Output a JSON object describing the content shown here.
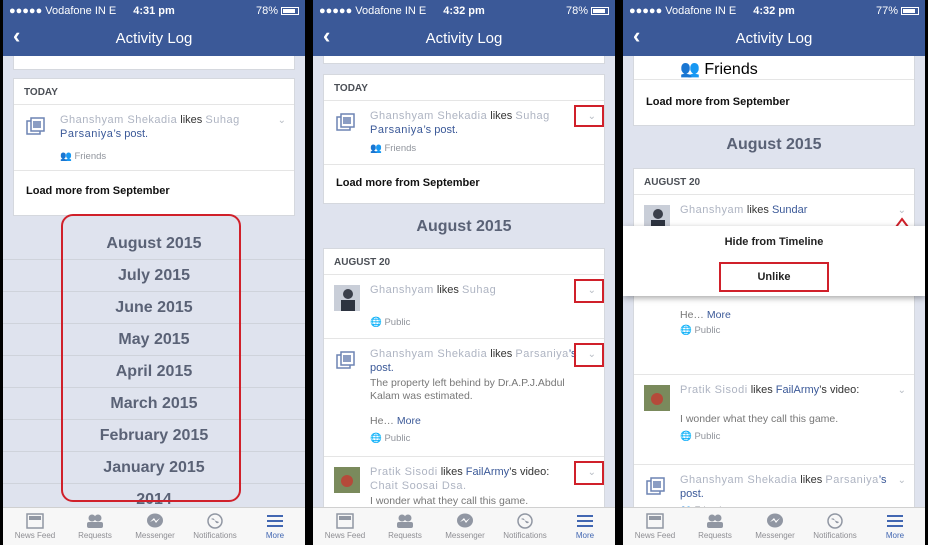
{
  "status": {
    "p1": {
      "carrier": "●●●●● Vodafone IN  E",
      "time": "4:31 pm",
      "battery": "78%"
    },
    "p2": {
      "carrier": "●●●●● Vodafone IN  E",
      "time": "4:32 pm",
      "battery": "78%"
    },
    "p3": {
      "carrier": "●●●●● Vodafone IN  E",
      "time": "4:32 pm",
      "battery": "77%"
    }
  },
  "nav": {
    "back": "‹",
    "title": "Activity Log"
  },
  "labels": {
    "today": "TODAY",
    "aug20": "AUGUST 20",
    "load_more": "Load more from September",
    "aug2015": "August 2015",
    "likes": "likes",
    "post": "’s post.",
    "video": "’s video:",
    "friends": "Friends",
    "public": "Public",
    "more": "More",
    "he": "He…",
    "property": "The property left behind by Dr.A.P.J.Abdul Kalam was estimated.",
    "wonder": "I wonder what they call this game.",
    "failarmy": "FailArmy",
    "sundar": "Sundar"
  },
  "blurred": {
    "name1": "Ghanshyam Shekadia",
    "name2": "Suhag",
    "name3": "Parsaniya",
    "name4": "Ghanshyam",
    "name5": "Pratik Sisodi",
    "name6": "Chait Soosai Dsa."
  },
  "months": [
    "August 2015",
    "July 2015",
    "June 2015",
    "May 2015",
    "April 2015",
    "March 2015",
    "February 2015",
    "January 2015",
    "2014"
  ],
  "popup": {
    "hide": "Hide from Timeline",
    "unlike": "Unlike"
  },
  "tabs": [
    "News Feed",
    "Requests",
    "Messenger",
    "Notifications",
    "More"
  ],
  "colors": {
    "brand": "#3b5998",
    "highlight": "#d0202a"
  }
}
